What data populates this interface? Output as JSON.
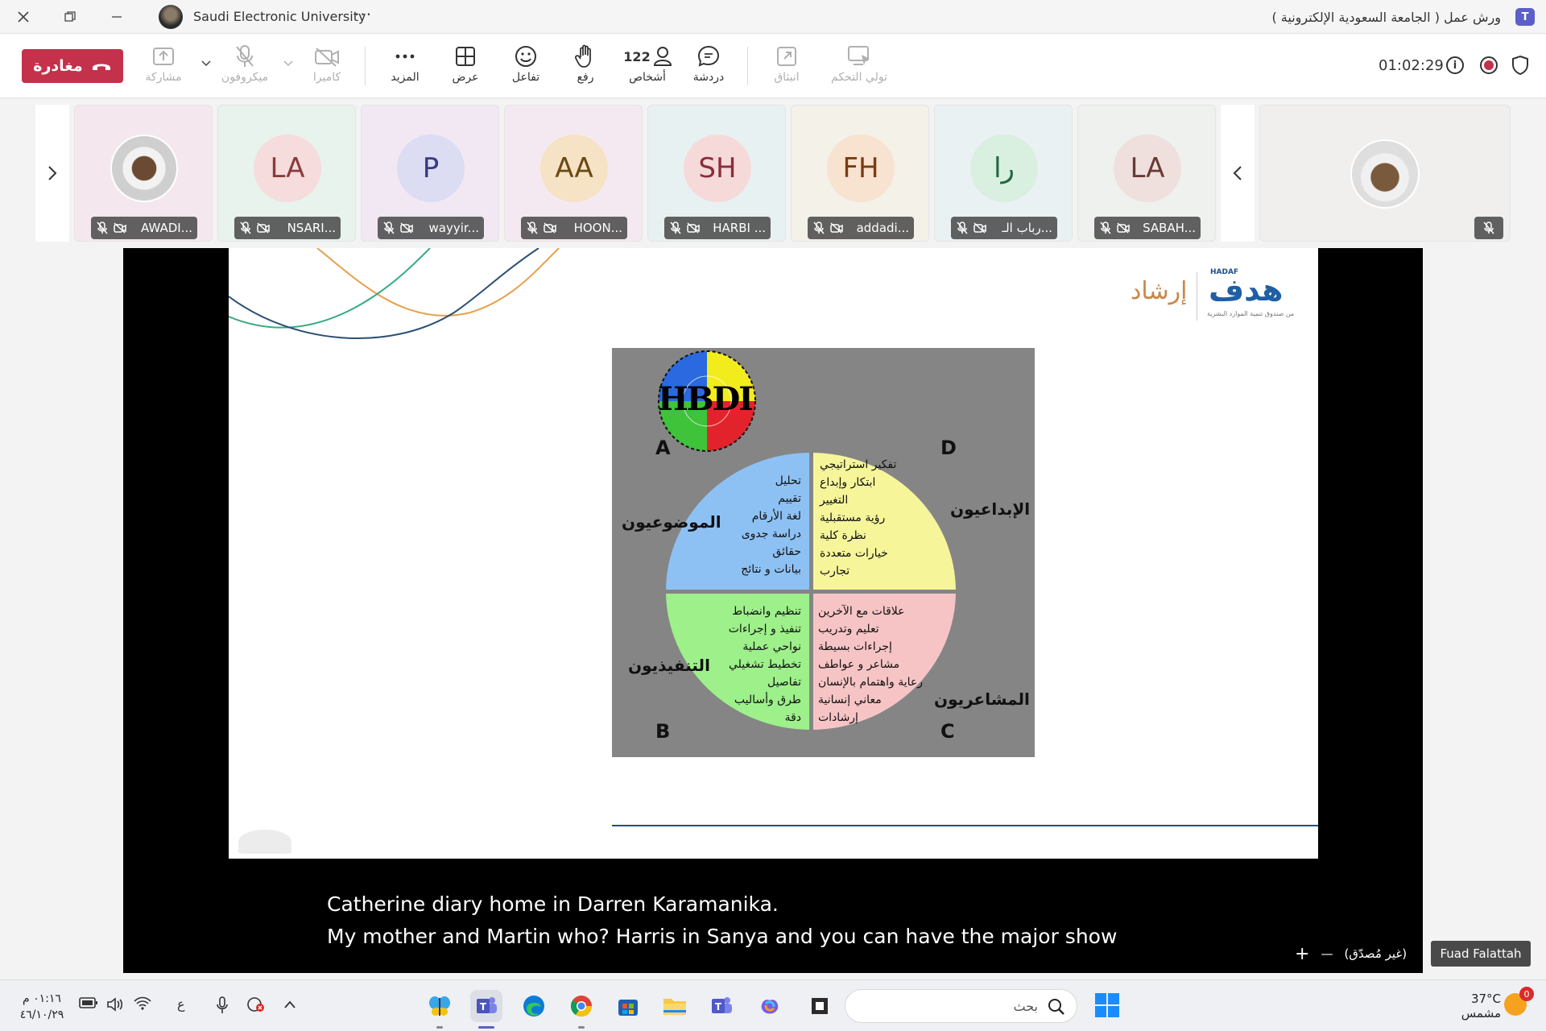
{
  "window": {
    "org_name": "Saudi Electronic University",
    "more_dots": "···",
    "meeting_title": "ورش عمل ( الجامعة السعودية الإلكترونية )",
    "teams_logo": "T"
  },
  "toolbar": {
    "leave_label": "مغادرة",
    "share_label": "مشاركة",
    "mic_label": "ميكروفون",
    "camera_label": "كاميرا",
    "more_label": "المزيد",
    "view_label": "عرض",
    "react_label": "تفاعل",
    "raise_label": "رفع",
    "people_label": "أشخاص",
    "people_count": "122",
    "chat_label": "دردشة",
    "popout_label": "انبثاق",
    "control_label": "تولي التحكم",
    "timer": "01:02:29",
    "info_glyph": "i"
  },
  "participants": [
    {
      "initials": "",
      "name": "AWADI...",
      "bg": "#f4e8ee",
      "avatar_bg": "#d8d8d8",
      "photo": true
    },
    {
      "initials": "LA",
      "name": "NSARI...",
      "bg": "#e8f3ee",
      "avatar_bg": "#f6dcdc",
      "avatar_fg": "#8a3b3b"
    },
    {
      "initials": "P",
      "name": "wayyir...",
      "bg": "#f2e8f3",
      "avatar_bg": "#dcdcf3",
      "avatar_fg": "#3a3a80"
    },
    {
      "initials": "AA",
      "name": "HOON...",
      "bg": "#f5e9f1",
      "avatar_bg": "#f6e2c4",
      "avatar_fg": "#6b4a12"
    },
    {
      "initials": "SH",
      "name": "HARBI ...",
      "bg": "#e8f1f1",
      "avatar_bg": "#f6dada",
      "avatar_fg": "#8a2d3d"
    },
    {
      "initials": "FH",
      "name": "addadi...",
      "bg": "#f3f1e8",
      "avatar_bg": "#f8e2d0",
      "avatar_fg": "#7a3c10"
    },
    {
      "initials": "را",
      "name": "رباب الـ...",
      "bg": "#eaf1f3",
      "avatar_bg": "#d9efdf",
      "avatar_fg": "#226640"
    },
    {
      "initials": "LA",
      "name": "SABAH...",
      "bg": "#eef1ee",
      "avatar_bg": "#efe0de",
      "avatar_fg": "#6a3a34"
    }
  ],
  "slide": {
    "brand_text": "إرشاد",
    "logo_text": "هدف",
    "logo_small": "HADAF",
    "logo_sub": "من صندوق تنمية الموارد البشرية",
    "hbdi_title": "HBDI",
    "quadrants": {
      "A": {
        "letter": "A",
        "label": "الموضوعيون",
        "items": [
          "تحليل",
          "تقييم",
          "لغة الأرقام",
          "دراسة جدوى",
          "حقائق",
          "بيانات و نتائج"
        ],
        "color": "#8ec1f3"
      },
      "D": {
        "letter": "D",
        "label": "الإبداعيون",
        "items": [
          "تفكير استراتيجي",
          "ابتكار وإبداع",
          "التغيير",
          "رؤية مستقبلية",
          "نظرة كلية",
          "خيارات متعددة",
          "تجارب"
        ],
        "color": "#f6f59a"
      },
      "B": {
        "letter": "B",
        "label": "التنفيذيون",
        "items": [
          "تنظيم وانضباط",
          "تنفيذ و إجراءات",
          "نواحي عملية",
          "تخطيط تشغيلي",
          "تفاصيل",
          "طرق وأساليب",
          "دقة"
        ],
        "color": "#9df08a"
      },
      "C": {
        "letter": "C",
        "label": "المشاعريون",
        "items": [
          "علاقات مع الآخرين",
          "تعليم وتدريب",
          "إجراءات بسيطة",
          "مشاعر و عواطف",
          "رعاية واهتمام بالإنسان",
          "معاني إنسانية",
          "إرشادات"
        ],
        "color": "#f7c4c6"
      }
    }
  },
  "caption": {
    "line1": "Catherine diary home in Darren Karamanika.",
    "line2": "My mother and Martin who? Harris in Sanya and you can have the major show"
  },
  "presenter": {
    "name": "Fuad Falattah",
    "status": "(غير مُصدّق)",
    "minus": "—",
    "plus": "+"
  },
  "taskbar": {
    "search_placeholder": "بحث",
    "weather_temp": "37°C",
    "weather_desc": "مشمس",
    "weather_badge": "0",
    "time": "٠١:١٦ م",
    "date": "٤٦/١٠/٢٩",
    "lang": "ع"
  }
}
